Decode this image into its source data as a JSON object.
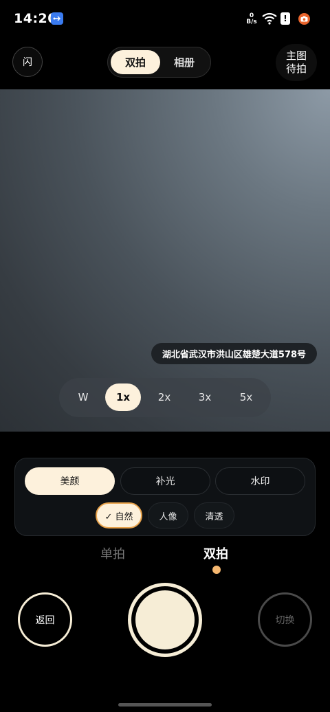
{
  "status_bar": {
    "time": "14:20",
    "net_speed_value": "0",
    "net_speed_unit": "B/s",
    "alert_glyph": "!",
    "icons": [
      "usb-icon",
      "wifi-icon",
      "alert-icon",
      "camera-notification-icon"
    ]
  },
  "top_bar": {
    "flash_label": "闪",
    "modes": [
      {
        "label": "双拍",
        "active": true
      },
      {
        "label": "相册",
        "active": false
      }
    ],
    "standby_line1": "主图",
    "standby_line2": "待拍"
  },
  "viewfinder": {
    "location": "湖北省武汉市洪山区雄楚大道578号",
    "zoom_options": [
      {
        "label": "W",
        "active": false
      },
      {
        "label": "1x",
        "active": true
      },
      {
        "label": "2x",
        "active": false
      },
      {
        "label": "3x",
        "active": false
      },
      {
        "label": "5x",
        "active": false
      }
    ]
  },
  "effect_panel": {
    "tabs": [
      {
        "label": "美颜",
        "active": true
      },
      {
        "label": "补光",
        "active": false
      },
      {
        "label": "水印",
        "active": false
      }
    ],
    "styles": [
      {
        "label": "✓ 自然",
        "active": true
      },
      {
        "label": "人像",
        "active": false
      },
      {
        "label": "清透",
        "active": false
      }
    ]
  },
  "camera_modes": {
    "single": "单拍",
    "dual": "双拍",
    "active": "dual"
  },
  "bottom_controls": {
    "back_label": "返回",
    "switch_label": "切换"
  },
  "colors": {
    "accent_cream": "#fdf1dc",
    "accent_orange": "#e8a24a",
    "mode_dot": "#f6b870",
    "usb_blue": "#3a7bf0",
    "notif_orange": "#e8642c"
  }
}
